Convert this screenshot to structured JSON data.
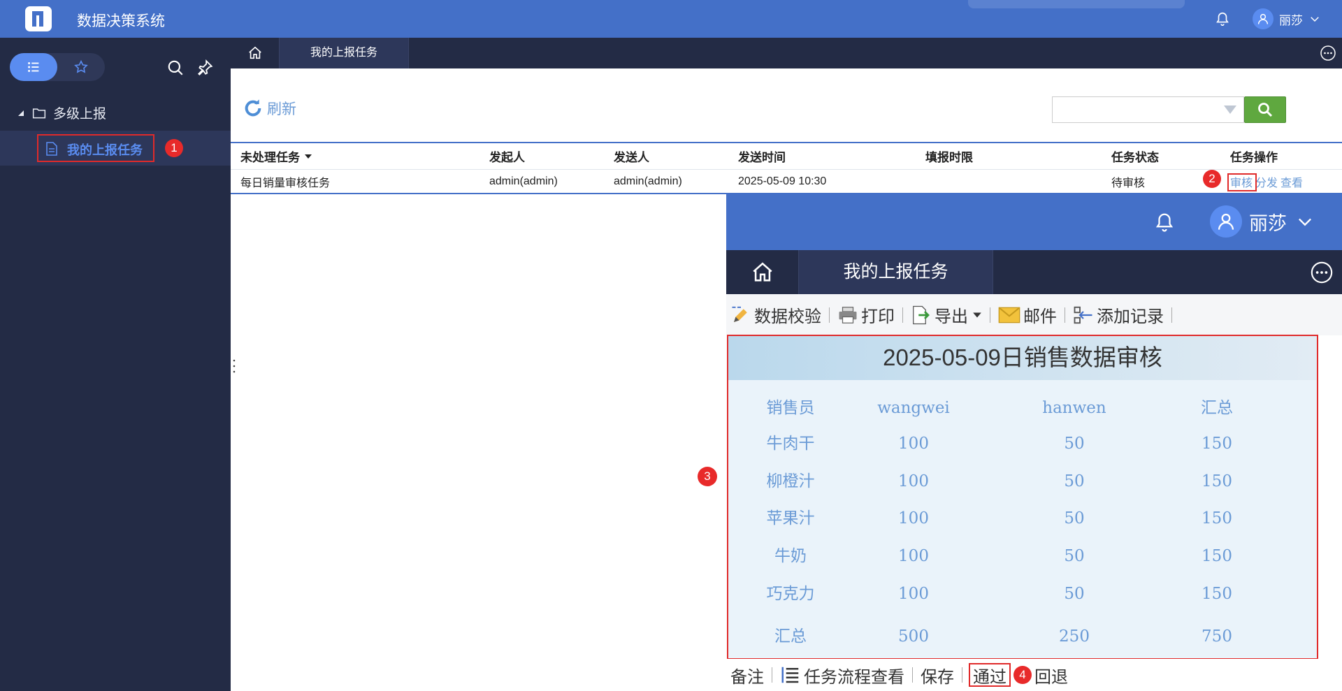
{
  "app": {
    "title": "数据决策系统",
    "user": "丽莎"
  },
  "sidebar": {
    "tree": {
      "root_label": "多级上报",
      "child_label": "我的上报任务"
    }
  },
  "tabs": {
    "active_tab": "我的上报任务"
  },
  "toolbar": {
    "refresh_label": "刷新"
  },
  "table": {
    "columns": [
      "未处理任务",
      "发起人",
      "发送人",
      "发送时间",
      "填报时限",
      "任务状态",
      "任务操作"
    ],
    "rows": [
      {
        "task": "每日销量审核任务",
        "initiator": "admin(admin)",
        "sender": "admin(admin)",
        "send_time": "2025-05-09 10:30",
        "deadline": "",
        "status": "待审核",
        "ops": [
          "审核",
          "分发",
          "查看"
        ]
      }
    ]
  },
  "zoom": {
    "user": "丽莎",
    "tab": "我的上报任务",
    "toolbar": [
      "数据校验",
      "打印",
      "导出",
      "邮件",
      "添加记录"
    ],
    "report": {
      "title": "2025-05-09日销售数据审核",
      "header": [
        "销售员",
        "wangwei",
        "hanwen",
        "汇总"
      ],
      "rows": [
        [
          "牛肉干",
          "100",
          "50",
          "150"
        ],
        [
          "柳橙汁",
          "100",
          "50",
          "150"
        ],
        [
          "苹果汁",
          "100",
          "50",
          "150"
        ],
        [
          "牛奶",
          "100",
          "50",
          "150"
        ],
        [
          "巧克力",
          "100",
          "50",
          "150"
        ],
        [
          "汇总",
          "500",
          "250",
          "750"
        ]
      ]
    },
    "bottom": [
      "备注",
      "任务流程查看",
      "保存",
      "通过",
      "回退"
    ]
  },
  "badges": [
    "1",
    "2",
    "3",
    "4"
  ],
  "colors": {
    "header_blue": "#4470c8",
    "sidebar_navy": "#232b45",
    "accent": "#5a8cf0",
    "link": "#6b9bd6",
    "highlight_red": "#e02a2a",
    "search_green": "#5fa83f"
  }
}
